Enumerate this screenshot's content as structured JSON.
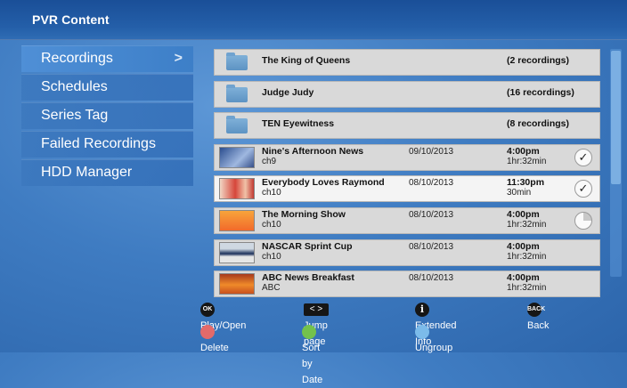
{
  "header": {
    "title": "PVR Content"
  },
  "menu": {
    "items": [
      {
        "label": "Recordings",
        "active": true,
        "chevron": ">"
      },
      {
        "label": "Schedules"
      },
      {
        "label": "Series Tag"
      },
      {
        "label": "Failed Recordings"
      },
      {
        "label": "HDD Manager"
      }
    ]
  },
  "content": {
    "rows": [
      {
        "type": "folder",
        "title": "The King of Queens",
        "count": "(2 recordings)",
        "icon": "folder-icon"
      },
      {
        "type": "folder",
        "title": "Judge Judy",
        "count": "(16 recordings)",
        "icon": "folder-icon"
      },
      {
        "type": "folder",
        "title": "TEN Eyewitness",
        "count": "(8 recordings)",
        "icon": "folder-icon"
      },
      {
        "type": "recording",
        "title": "Nine's Afternoon News",
        "channel": "ch9",
        "date": "09/10/2013",
        "time": "4:00pm",
        "duration": "1hr:32min",
        "status": "watched",
        "status_symbol": "✓"
      },
      {
        "type": "recording",
        "title": "Everybody Loves Raymond",
        "channel": "ch10",
        "date": "08/10/2013",
        "time": "11:30pm",
        "duration": "30min",
        "status": "watched",
        "status_symbol": "✓",
        "selected": true
      },
      {
        "type": "recording",
        "title": "The Morning Show",
        "channel": "ch10",
        "date": "08/10/2013",
        "time": "4:00pm",
        "duration": "1hr:32min",
        "status": "partial"
      },
      {
        "type": "recording",
        "title": "NASCAR Sprint Cup",
        "channel": "ch10",
        "date": "08/10/2013",
        "time": "4:00pm",
        "duration": "1hr:32min",
        "status": "none"
      },
      {
        "type": "recording",
        "title": "ABC News Breakfast",
        "channel": "ABC",
        "date": "08/10/2013",
        "time": "4:00pm",
        "duration": "1hr:32min",
        "status": "none"
      }
    ]
  },
  "legend": {
    "ok": {
      "key": "OK",
      "label": "Play/Open"
    },
    "jump": {
      "key": "< >",
      "label": "Jump page"
    },
    "info": {
      "key": "i",
      "label": "Extended Info"
    },
    "back": {
      "key": "BACK",
      "label": "Back"
    },
    "red": {
      "label": "Delete",
      "color": "#e36a6a"
    },
    "green": {
      "label": "Sort by Date",
      "color": "#73c24c"
    },
    "blue": {
      "label": "Ungroup",
      "color": "#7cbbea"
    }
  },
  "colors": {
    "accent": "#2f6cb4",
    "row_bg": "#d9d9d9",
    "selected_row_bg": "#f4f4f4"
  }
}
